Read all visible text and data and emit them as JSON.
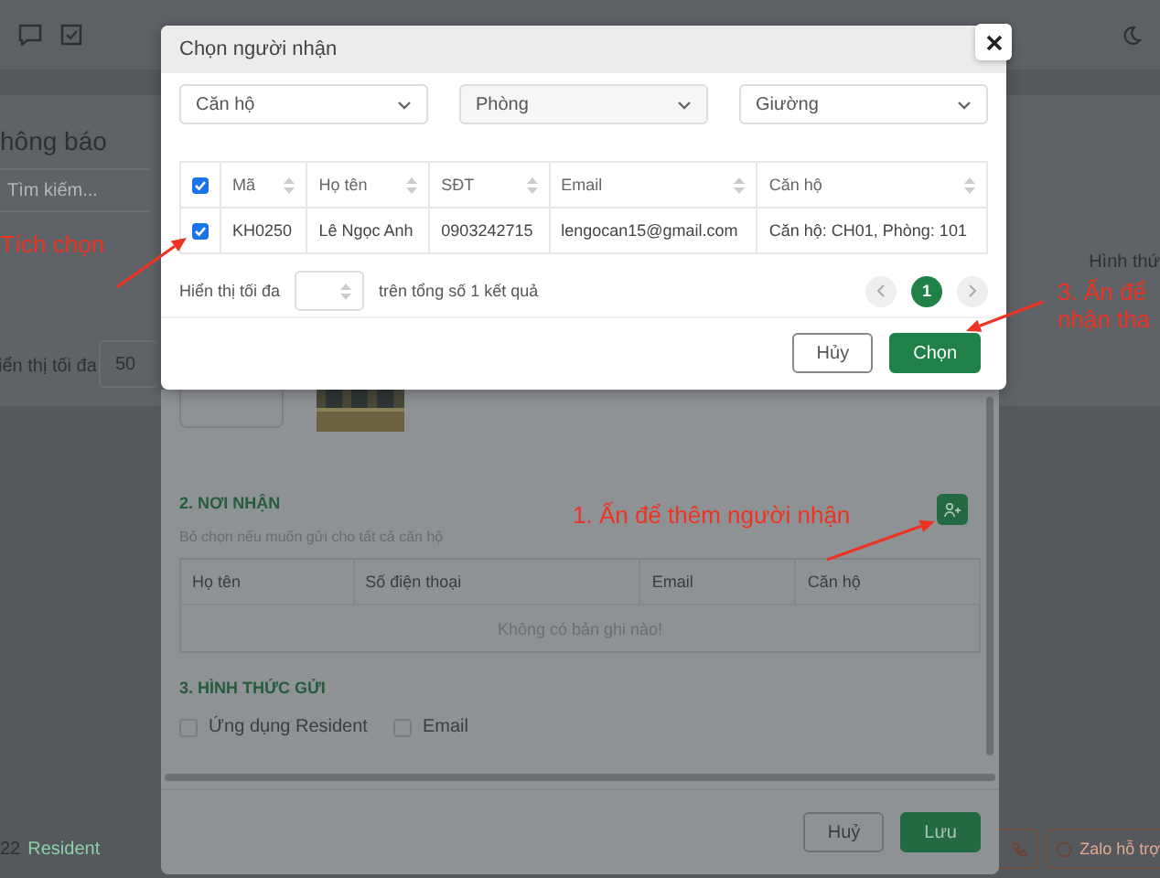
{
  "page": {
    "title": "hông báo",
    "search": {
      "placeholder": "Tìm kiếm..."
    },
    "column_header": "Hình thứ",
    "page_size_label": "iển thị tối đa",
    "page_size": "50",
    "footer_number": "22",
    "footer_link": "Resident",
    "support_button": "Zalo hỗ trợ"
  },
  "form": {
    "recipients": {
      "title": "2. NƠI NHẬN",
      "hint": "Bỏ chọn nếu muốn gửi cho tất cả căn hộ",
      "columns": [
        "Họ tên",
        "Số điện thoại",
        "Email",
        "Căn hộ"
      ],
      "empty_text": "Không có bản ghi nào!"
    },
    "send_methods": {
      "title": "3. HÌNH THỨC GỬI",
      "options": [
        {
          "label": "Ứng dụng Resident",
          "checked": false
        },
        {
          "label": "Email",
          "checked": false
        }
      ]
    },
    "buttons": [
      {
        "label": "Huỷ",
        "kind": "secondary"
      },
      {
        "label": "Lưu",
        "kind": "primary"
      }
    ]
  },
  "dialog": {
    "title": "Chọn người nhận",
    "filters": [
      {
        "placeholder": "Căn hộ"
      },
      {
        "placeholder": "Phòng"
      },
      {
        "placeholder": "Giường"
      }
    ],
    "select_all": true,
    "columns": [
      "Mã",
      "Họ tên",
      "SĐT",
      "Email",
      "Căn hộ"
    ],
    "rows": [
      {
        "checked": true,
        "cells": [
          "KH0250",
          "Lê Ngọc Anh",
          "0903242715",
          "lengocan15@gmail.com",
          "Căn hộ: CH01, Phòng: 101"
        ]
      }
    ],
    "page_size_label": "Hiển thị tối đa",
    "total_label": "trên tổng số 1 kết quả",
    "pages": [
      {
        "label": "1",
        "selected": true
      }
    ],
    "buttons": [
      {
        "label": "Hủy",
        "kind": "secondary"
      },
      {
        "label": "Chọn",
        "kind": "primary"
      }
    ]
  },
  "annotations": [
    {
      "kind": "check",
      "lines": [
        "Tích chọn"
      ]
    },
    {
      "kind": "add",
      "lines": [
        "1. Ấn để thêm người nhận"
      ]
    },
    {
      "kind": "confirm",
      "lines": [
        "3. Ấn để",
        "nhận tha"
      ]
    }
  ]
}
